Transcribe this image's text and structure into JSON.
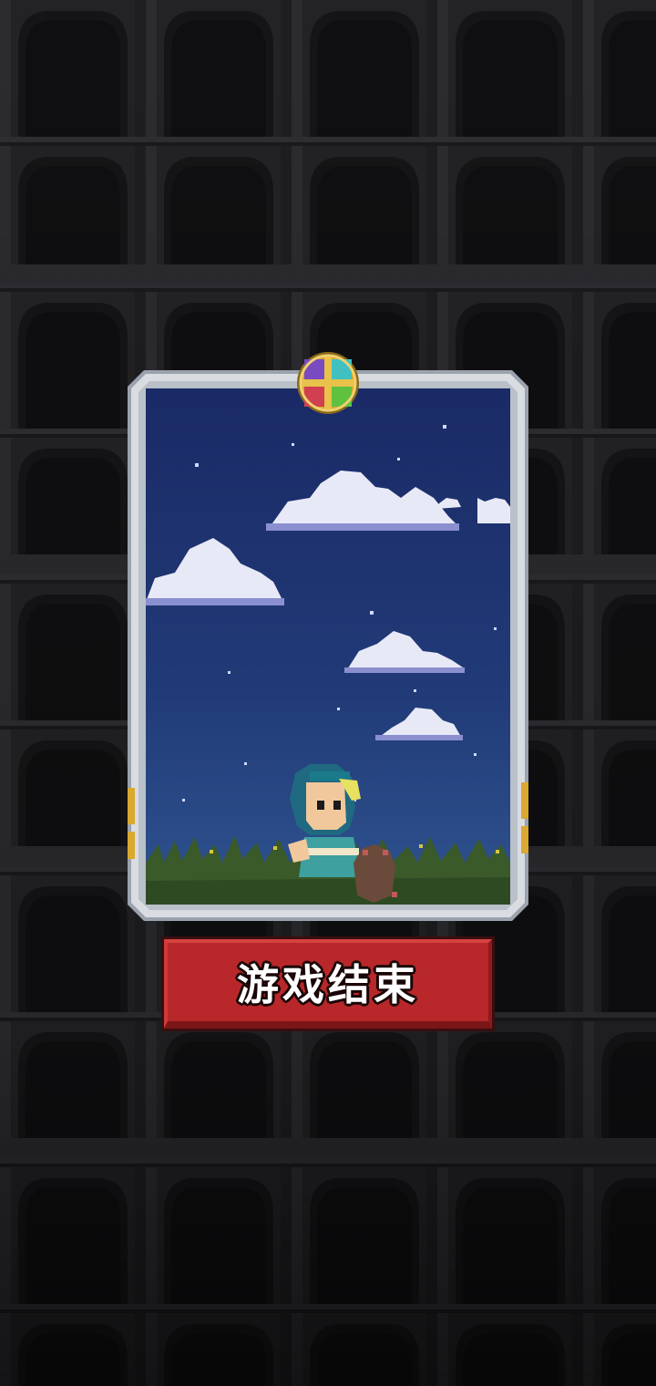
{
  "screen": {
    "name": "game-over-screen"
  },
  "button": {
    "game_over_label": "游戏结束"
  },
  "colors": {
    "background": "#1a1a1c",
    "wall_dark": "#141416",
    "wall_mid": "#2a2a2e",
    "card_frame": "#d9dde2",
    "sky_top": "#1a2a66",
    "sky_bottom": "#2f5490",
    "grass": "#3a5a2a",
    "button_red": "#b8282a",
    "emblem_gold": "#d9a930"
  },
  "icons": {
    "emblem": "compass-emblem-icon",
    "hero": "hooded-hero-icon",
    "pet": "rat-companion-icon"
  }
}
